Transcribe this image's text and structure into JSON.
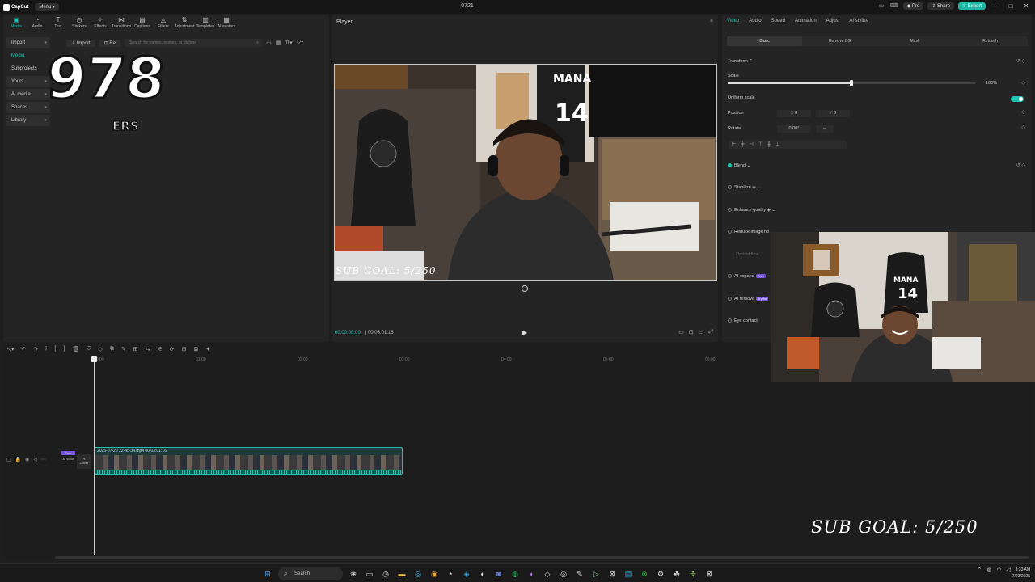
{
  "app": {
    "name": "CapCut",
    "menu_label": "Menu",
    "window_title": "0721"
  },
  "titlebar": {
    "pro_label": "Pro",
    "share_label": "Share",
    "export_label": "Export"
  },
  "media_toolbar": {
    "items": [
      {
        "label": "Media",
        "icon": "media-icon"
      },
      {
        "label": "Audio",
        "icon": "audio-icon"
      },
      {
        "label": "Text",
        "icon": "text-icon"
      },
      {
        "label": "Stickers",
        "icon": "sticker-icon"
      },
      {
        "label": "Effects",
        "icon": "effects-icon"
      },
      {
        "label": "Transitions",
        "icon": "transition-icon"
      },
      {
        "label": "Captions",
        "icon": "captions-icon"
      },
      {
        "label": "Filters",
        "icon": "filter-icon"
      },
      {
        "label": "Adjustment",
        "icon": "adjust-icon"
      },
      {
        "label": "Templates",
        "icon": "template-icon"
      },
      {
        "label": "AI avatars",
        "icon": "avatar-icon"
      }
    ]
  },
  "sidenav": {
    "items": [
      {
        "label": "Import"
      },
      {
        "label": "Media"
      },
      {
        "label": "Subprojects"
      },
      {
        "label": "Yours"
      },
      {
        "label": "AI media"
      },
      {
        "label": "Spaces"
      },
      {
        "label": "Library"
      }
    ]
  },
  "media_top": {
    "import_label": "Import",
    "record_label": "Re",
    "search_placeholder": "Search for names, scenes, or dialogs"
  },
  "overlay_logo": {
    "number": "978",
    "sub": "ERS"
  },
  "player": {
    "title": "Player",
    "current_time": "00:00:00:00",
    "total_time": "00:03:01:16",
    "sub_goal_text": "SUB GOAL: 5/250"
  },
  "props": {
    "tabs": [
      "Video",
      "Audio",
      "Speed",
      "Animation",
      "Adjust",
      "AI stylize"
    ],
    "subtabs": [
      "Basic",
      "Remove BG",
      "Mask",
      "Retouch"
    ],
    "transform_label": "Transform",
    "scale_label": "Scale",
    "scale_value": "100%",
    "scale_level": 1.0,
    "uniform_scale_label": "Uniform scale",
    "position_label": "Position",
    "position_x": "0",
    "position_y": "0",
    "x_label": "X",
    "y_label": "Y",
    "rotate_label": "Rotate",
    "rotate_value": "0.00°",
    "blend_label": "Blend",
    "stabilize_label": "Stabilize",
    "enhance_label": "Enhance quality",
    "reduce_noise_label": "Reduce image no",
    "optical_flow_label": "Optical flow",
    "ai_expand_label": "AI expand",
    "ai_remove_label": "AI remove",
    "eye_contact_label": "Eye contact",
    "free_badge": "Free",
    "try_badge": "Try for"
  },
  "timeline": {
    "ruler": [
      "00:00",
      "01:00",
      "02:00",
      "03:00",
      "04:00",
      "05:00",
      "06:00"
    ],
    "clip_name": "2025-07-20 22-45-34.mp4",
    "clip_duration": "00:03:01:16",
    "cover_label": "Cover",
    "free_badge": "Free",
    "ai_voice_label": "AI voice"
  },
  "stream_overlay": {
    "sub_goal_text": "SUB GOAL: 5/250"
  },
  "taskbar": {
    "search_label": "Search",
    "time": "3:33 AM",
    "date": "7/23/2025"
  },
  "colors": {
    "accent": "#1fc2b0",
    "panel": "#242424",
    "badge": "#7a55e8"
  }
}
